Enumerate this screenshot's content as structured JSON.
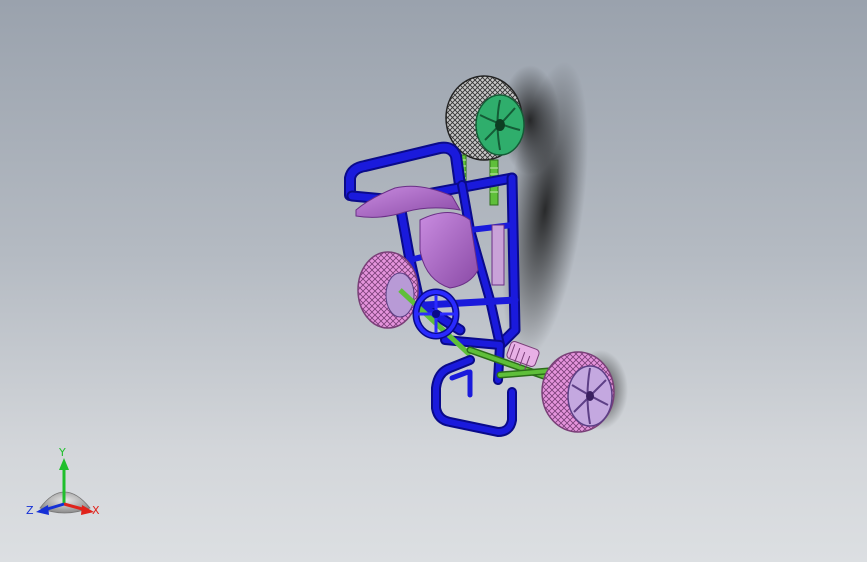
{
  "triad": {
    "axes": [
      {
        "name": "Y",
        "color": "#1fbf2c"
      },
      {
        "name": "X",
        "color": "#e0231b"
      },
      {
        "name": "Z",
        "color": "#1530d6"
      }
    ]
  },
  "model": {
    "icon": "go-kart-3d-model",
    "colors": {
      "frame": "#1a1adc",
      "frame_dark": "#0a0a8a",
      "seat": "#b070c8",
      "tire": "#e08ad8",
      "rear_wheel_rim": "#33b070",
      "front_wheel_rim": "#c4a8e0",
      "suspension": "#5fbf3a",
      "shadow": "#1c1c22"
    }
  }
}
